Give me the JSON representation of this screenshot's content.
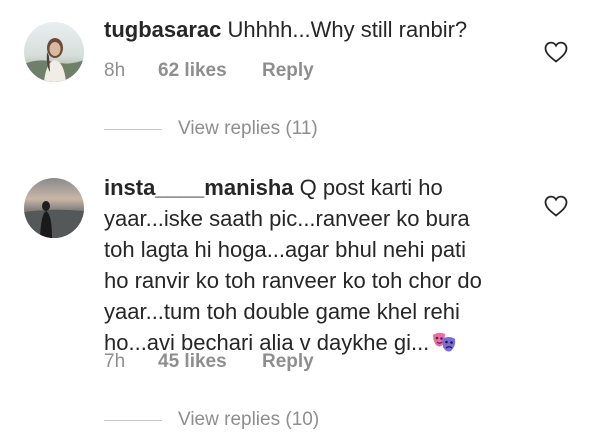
{
  "comments": [
    {
      "username": "tugbasarac",
      "text": " Uhhhh...Why still ranbir?",
      "time": "8h",
      "likes": "62 likes",
      "reply_label": "Reply",
      "view_replies": "View replies (11)",
      "avatar_icon": "profile-photo-icon"
    },
    {
      "username": "insta____manisha",
      "text_lines": [
        " Q post karti ho",
        "yaar...iske saath pic...ranveer ko bura",
        "toh lagta hi hoga...agar bhul nehi pati",
        "ho ranvir ko toh ranveer ko toh chor do",
        "yaar...tum toh double game khel rehi",
        "ho...avi bechari alia v daykhe gi..."
      ],
      "emoji": "performing-arts-masks",
      "time": "7h",
      "likes": "45 likes",
      "reply_label": "Reply",
      "view_replies": "View replies (10)",
      "avatar_icon": "profile-photo-icon"
    }
  ],
  "colors": {
    "text": "#262626",
    "secondary": "#8e8e8e",
    "divider": "#c7c7c7"
  }
}
